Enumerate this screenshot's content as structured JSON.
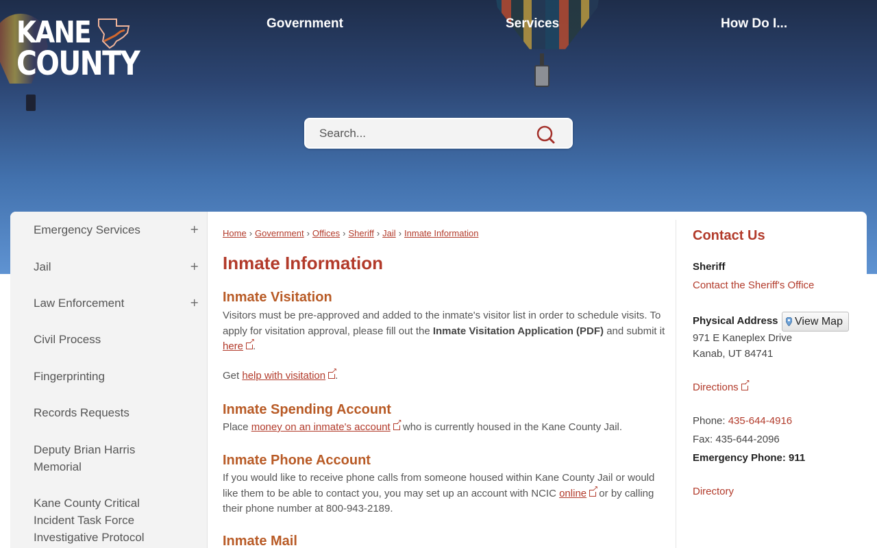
{
  "brand": {
    "logo_line1": "KANE",
    "logo_line2": "COUNTY"
  },
  "topnav": [
    "Government",
    "Services",
    "How Do I..."
  ],
  "search": {
    "placeholder": "Search..."
  },
  "sidebar": {
    "items": [
      {
        "label": "Emergency Services",
        "expandable": true
      },
      {
        "label": "Jail",
        "expandable": true
      },
      {
        "label": "Law Enforcement",
        "expandable": true
      },
      {
        "label": "Civil Process",
        "expandable": false
      },
      {
        "label": "Fingerprinting",
        "expandable": false
      },
      {
        "label": "Records Requests",
        "expandable": false
      },
      {
        "label": "Deputy Brian Harris Memorial",
        "expandable": false
      },
      {
        "label": "Kane County Critical Incident Task Force Investigative Protocol",
        "expandable": false
      }
    ]
  },
  "breadcrumb": [
    "Home",
    "Government",
    "Offices",
    "Sheriff",
    "Jail",
    "Inmate Information"
  ],
  "page": {
    "title": "Inmate Information",
    "visitation": {
      "heading": "Inmate Visitation",
      "text_1": "Visitors must be pre-approved and added to the inmate's visitor list in order to schedule visits. To apply for visitation approval, please fill out the ",
      "app_label": "Inmate Visitation Application (PDF)",
      "text_2": " and submit it ",
      "here_link": "here",
      "text_3": ".",
      "get_text": "Get ",
      "help_link": "help with visitation",
      "get_end": "."
    },
    "spending": {
      "heading": "Inmate Spending Account",
      "text_1": "Place ",
      "link": "money on an inmate's account",
      "text_2": " who is currently housed in the Kane County Jail."
    },
    "phone": {
      "heading": "Inmate Phone Account",
      "text_1": "If you would like to receive phone calls from someone housed within Kane County Jail or would like them to be able to contact you, you may set up an account with NCIC ",
      "link": "online",
      "text_2": " or by calling their phone number at 800-943-2189."
    },
    "mail": {
      "heading": "Inmate Mail"
    }
  },
  "contact": {
    "heading": "Contact Us",
    "dept": "Sheriff",
    "dept_link": "Contact the Sheriff's Office",
    "address_label": "Physical Address",
    "map_button": "View Map",
    "street": "971 E Kaneplex Drive",
    "city": "Kanab, UT 84741",
    "directions": "Directions",
    "phone_label": "Phone: ",
    "phone": "435-644-4916",
    "fax": "Fax: 435-644-2096",
    "emergency": "Emergency Phone: 911",
    "directory": "Directory"
  },
  "colors": {
    "accent": "#b23a2a",
    "heading_orange": "#b85a25",
    "sidebar_bg": "#f3f3f3"
  }
}
